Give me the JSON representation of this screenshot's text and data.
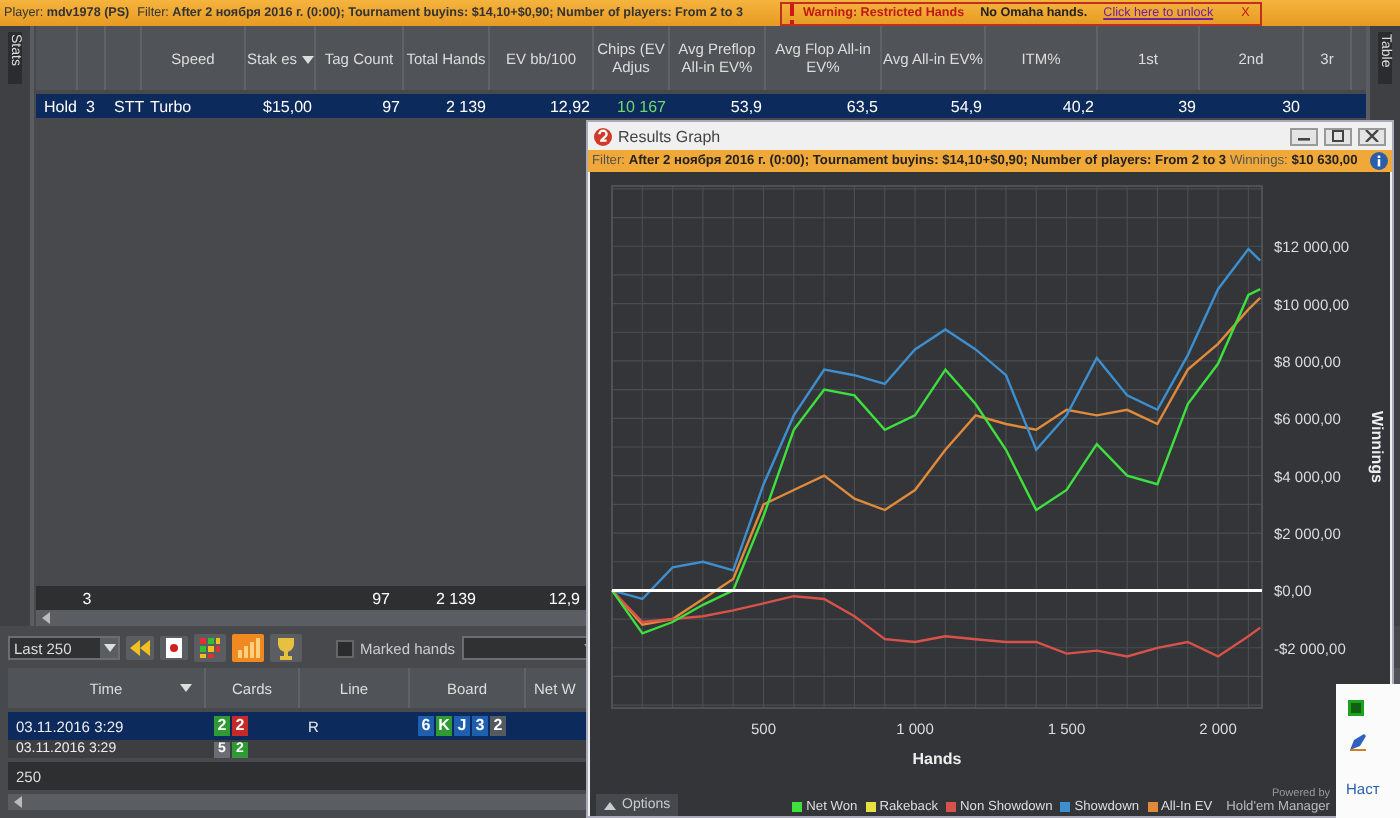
{
  "top_bar": {
    "player": "Player: **mdv1978 (PS)**",
    "filter": "Filter: **After 2 ноября 2016 г. (0:00); Tournament buyins: $14,10+$0,90; Number of players: From 2 to 3**",
    "warning": "Warning: Restricted Hands",
    "notice": "No Omaha hands.",
    "unlock_link": "Click here to unlock",
    "close": "X"
  },
  "side_tabs": {
    "left": "Stats",
    "right": "Table"
  },
  "stats_table": {
    "columns": [
      {},
      {},
      {},
      {
        "label": "Speed",
        "sorted": false
      },
      {
        "label": "Stak es",
        "sorted": true
      },
      {
        "label": "Tag Count",
        "sorted": false
      },
      {
        "label": "Total Hands",
        "sorted": false
      },
      {
        "label": "EV bb/100",
        "sorted": false
      },
      {
        "label": "Chips (EV Adjus",
        "sorted": false
      },
      {
        "label": "Avg Preflop All-in EV%",
        "sorted": false
      },
      {
        "label": "Avg Flop All-in EV%",
        "sorted": false
      },
      {
        "label": "Avg All-in EV%",
        "sorted": false
      },
      {
        "label": "ITM%",
        "sorted": false
      },
      {
        "label": "1st",
        "sorted": false
      },
      {
        "label": "2nd",
        "sorted": false
      },
      {
        "label": "3r",
        "sorted": false
      }
    ],
    "rows": [
      {
        "selected": true,
        "cells": [
          "Hold",
          "3",
          "STT",
          "Turbo",
          "$15,00",
          "97",
          "2 139",
          "12,92",
          "10 167",
          "53,9",
          "63,5",
          "54,9",
          "40,2",
          "39",
          "30"
        ]
      }
    ],
    "totals": {
      "players": "3",
      "tag_count": "97",
      "total_hands": "2 139",
      "ev_bb_100": "12,9"
    }
  },
  "toolbar": {
    "range": "Last 250",
    "views": [
      {
        "kind": "grid",
        "selected": false
      },
      {
        "kind": "chart",
        "selected": true
      },
      {
        "kind": "trophy",
        "selected": false
      }
    ],
    "marked_hands": {
      "label": "Marked hands",
      "checked": false
    }
  },
  "hands_table": {
    "columns": [
      {
        "label": "Time",
        "sorted": true
      },
      {
        "label": "Cards",
        "sorted": false
      },
      {
        "label": "Line",
        "sorted": false
      },
      {
        "label": "Board",
        "sorted": false
      },
      {
        "label": "Net W",
        "sorted": false
      }
    ],
    "rows": [
      {
        "selected": true,
        "time": "03.11.2016 3:29",
        "cards": [
          {
            "rank": "2",
            "color": "#2f9a34"
          },
          {
            "rank": "2",
            "color": "#c42a2a"
          }
        ],
        "line": "R",
        "board": [
          {
            "rank": "6",
            "color": "#1f5fb0"
          },
          {
            "rank": "K",
            "color": "#2f9a34"
          },
          {
            "rank": "J",
            "color": "#1f5fb0"
          },
          {
            "rank": "3",
            "color": "#1f5fb0"
          },
          {
            "rank": "2",
            "color": "#555a60"
          }
        ]
      },
      {
        "selected": false,
        "time": "03.11.2016 3:29",
        "cards": [
          {
            "rank": "5",
            "color": "#6a6e74"
          },
          {
            "rank": "2",
            "color": "#2f9a34"
          }
        ],
        "line": "",
        "board": []
      }
    ],
    "footer": "250"
  },
  "graph_window": {
    "title": "Results Graph",
    "filter": "Filter: **After 2 ноября 2016 г. (0:00); Tournament buyins: $14,10+$0,90; Number of players: From 2 to 3** Winnings: **$10 630,00**",
    "chart_data": {
      "type": "line",
      "xlabel": "Hands",
      "ylabel": "Winnings",
      "x": [
        0,
        100,
        200,
        300,
        400,
        500,
        600,
        700,
        800,
        900,
        1000,
        1100,
        1200,
        1300,
        1400,
        1500,
        1600,
        1700,
        1800,
        1900,
        2000,
        2100,
        2139
      ],
      "series": [
        {
          "name": "Net Won",
          "color": "#3ee03e",
          "values": [
            0,
            -1500,
            -1100,
            -500,
            0,
            2600,
            5600,
            7000,
            6800,
            5600,
            6100,
            7700,
            6500,
            4900,
            2800,
            3500,
            5100,
            4000,
            3700,
            6500,
            7900,
            10300,
            10500
          ]
        },
        {
          "name": "Rakeback",
          "color": "#e8e040",
          "values": [
            null,
            null,
            null,
            null,
            null,
            null,
            null,
            null,
            null,
            null,
            null,
            null,
            null,
            null,
            null,
            null,
            null,
            null,
            null,
            null,
            null,
            null,
            null
          ]
        },
        {
          "name": "Non Showdown",
          "color": "#d9524a",
          "values": [
            0,
            -1100,
            -1000,
            -900,
            -700,
            -450,
            -200,
            -300,
            -900,
            -1700,
            -1800,
            -1600,
            -1700,
            -1800,
            -1800,
            -2200,
            -2100,
            -2300,
            -2000,
            -1800,
            -2300,
            -1600,
            -1300
          ]
        },
        {
          "name": "Showdown",
          "color": "#3e8fd0",
          "values": [
            0,
            -300,
            800,
            1000,
            700,
            3700,
            6100,
            7700,
            7500,
            7200,
            8400,
            9100,
            8400,
            7500,
            4900,
            6100,
            8100,
            6800,
            6300,
            8200,
            10500,
            11900,
            11500
          ]
        },
        {
          "name": "All-In EV",
          "color": "#e08a3a",
          "values": [
            0,
            -1200,
            -1000,
            -300,
            400,
            3000,
            3500,
            4000,
            3200,
            2800,
            3500,
            4900,
            6100,
            5800,
            5600,
            6300,
            6100,
            6300,
            5800,
            7700,
            8600,
            9800,
            10200
          ]
        }
      ],
      "grid": true,
      "xlim": [
        0,
        2145
      ],
      "ylim": [
        -4100,
        14100
      ],
      "xticks": [
        {
          "value": 500,
          "label": "500"
        },
        {
          "value": 1000,
          "label": "1 000"
        },
        {
          "value": 1500,
          "label": "1 500"
        },
        {
          "value": 2000,
          "label": "2 000"
        }
      ],
      "yticks": [
        {
          "value": 12000,
          "label": "$12 000,00"
        },
        {
          "value": 10000,
          "label": "$10 000,00"
        },
        {
          "value": 8000,
          "label": "$8 000,00"
        },
        {
          "value": 6000,
          "label": "$6 000,00"
        },
        {
          "value": 4000,
          "label": "$4 000,00"
        },
        {
          "value": 2000,
          "label": "$2 000,00"
        },
        {
          "value": 0,
          "label": "$0,00"
        },
        {
          "value": -2000,
          "label": "-$2 000,00"
        }
      ]
    },
    "options": "Options",
    "powered_by": "Powered by",
    "brand": "Hold'em Manager"
  },
  "popup": {
    "text": "Наст"
  }
}
